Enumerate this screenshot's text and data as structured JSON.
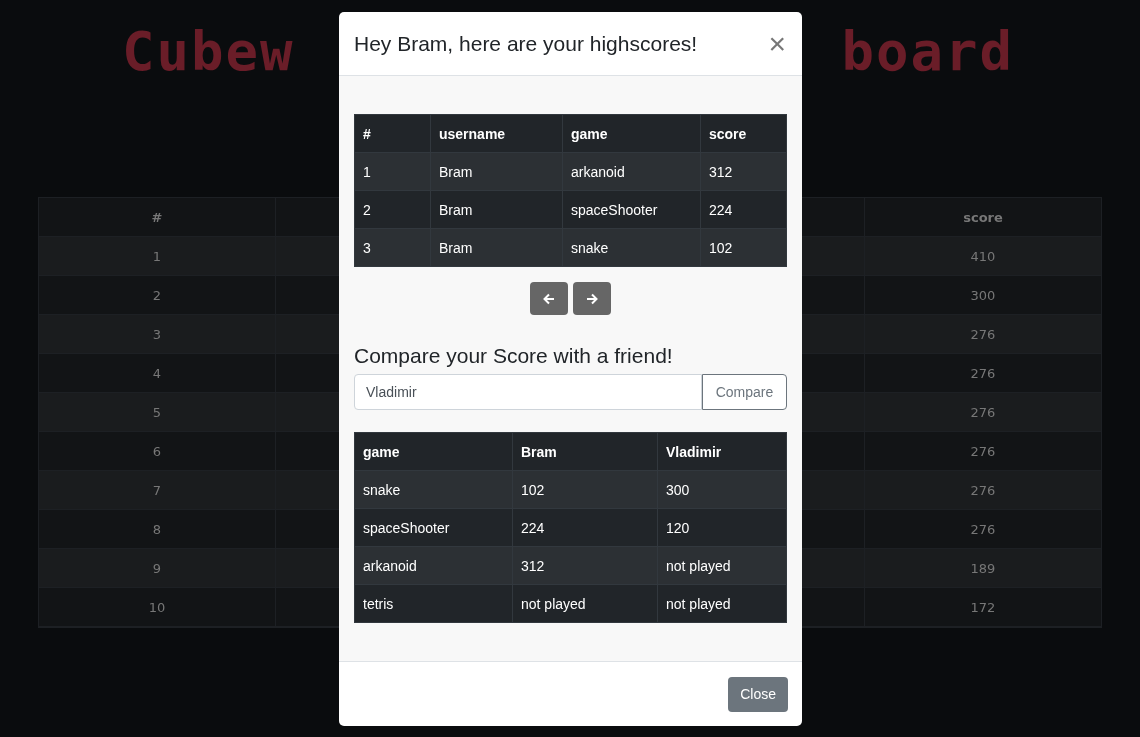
{
  "background": {
    "title_left": "Cubew",
    "title_right": "board",
    "table": {
      "columns": [
        "#",
        "score"
      ],
      "rows": [
        [
          "1",
          "410"
        ],
        [
          "2",
          "300"
        ],
        [
          "3",
          "276"
        ],
        [
          "4",
          "276"
        ],
        [
          "5",
          "276"
        ],
        [
          "6",
          "276"
        ],
        [
          "7",
          "276"
        ],
        [
          "8",
          "276"
        ],
        [
          "9",
          "189"
        ],
        [
          "10",
          "172"
        ]
      ]
    }
  },
  "modal": {
    "title": "Hey Bram, here are your highscores!",
    "close_icon": "×",
    "highscores": {
      "columns": [
        "#",
        "username",
        "game",
        "score"
      ],
      "rows": [
        [
          "1",
          "Bram",
          "arkanoid",
          "312"
        ],
        [
          "2",
          "Bram",
          "spaceShooter",
          "224"
        ],
        [
          "3",
          "Bram",
          "snake",
          "102"
        ]
      ]
    },
    "compare_heading": "Compare your Score with a friend!",
    "friend_field": {
      "value": "Vladimir"
    },
    "compare_button": "Compare",
    "comparison": {
      "columns": [
        "game",
        "Bram",
        "Vladimir"
      ],
      "rows": [
        [
          "snake",
          "102",
          "300"
        ],
        [
          "spaceShooter",
          "224",
          "120"
        ],
        [
          "arkanoid",
          "312",
          "not played"
        ],
        [
          "tetris",
          "not played",
          "not played"
        ]
      ]
    },
    "close_button": "Close"
  }
}
